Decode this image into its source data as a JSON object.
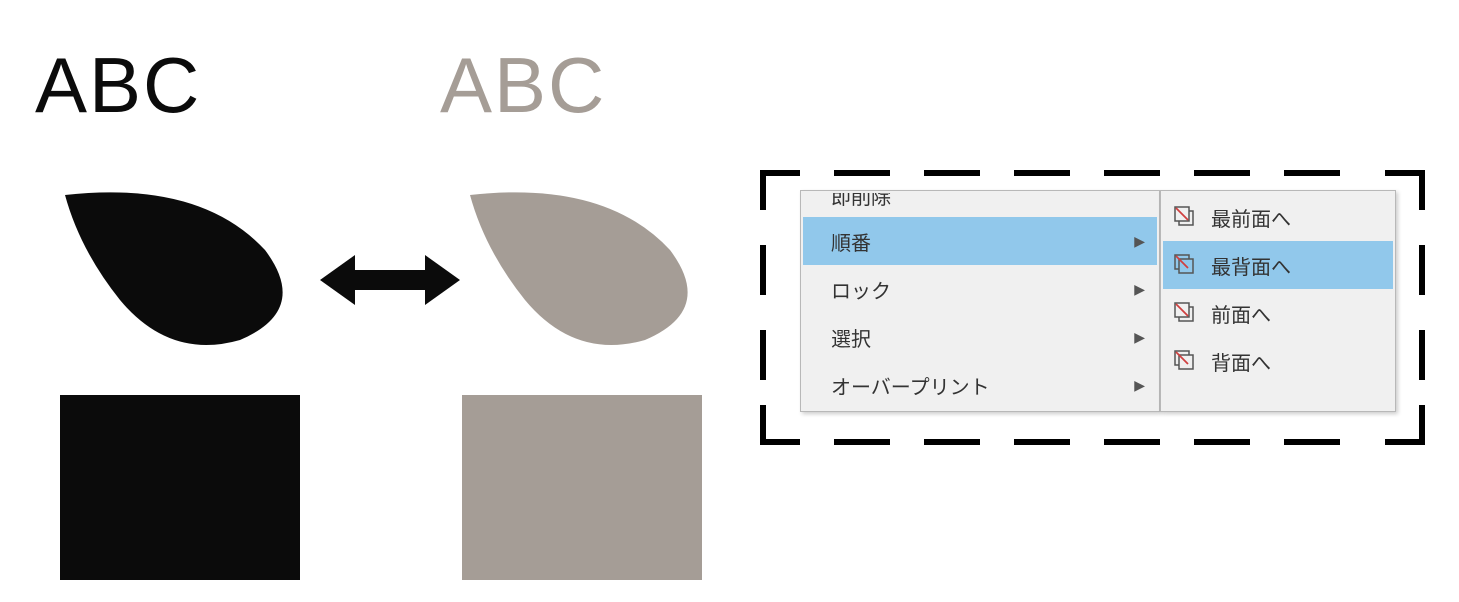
{
  "illustration": {
    "abc_black": "ABC",
    "abc_gray": "ABC"
  },
  "colors": {
    "black": "#0b0b0b",
    "gray": "#a59d96",
    "highlight": "#91c8eb",
    "menu_bg": "#f0f0f0"
  },
  "context_menu": {
    "partial_top": "即削除",
    "main": [
      {
        "label": "順番",
        "has_submenu": true,
        "highlighted": true
      },
      {
        "label": "ロック",
        "has_submenu": true,
        "highlighted": false
      },
      {
        "label": "選択",
        "has_submenu": true,
        "highlighted": false
      },
      {
        "label": "オーバープリント",
        "has_submenu": true,
        "highlighted": false
      }
    ],
    "sub": [
      {
        "label": "最前面へ",
        "highlighted": false
      },
      {
        "label": "最背面へ",
        "highlighted": true
      },
      {
        "label": "前面へ",
        "highlighted": false
      },
      {
        "label": "背面へ",
        "highlighted": false
      }
    ]
  }
}
